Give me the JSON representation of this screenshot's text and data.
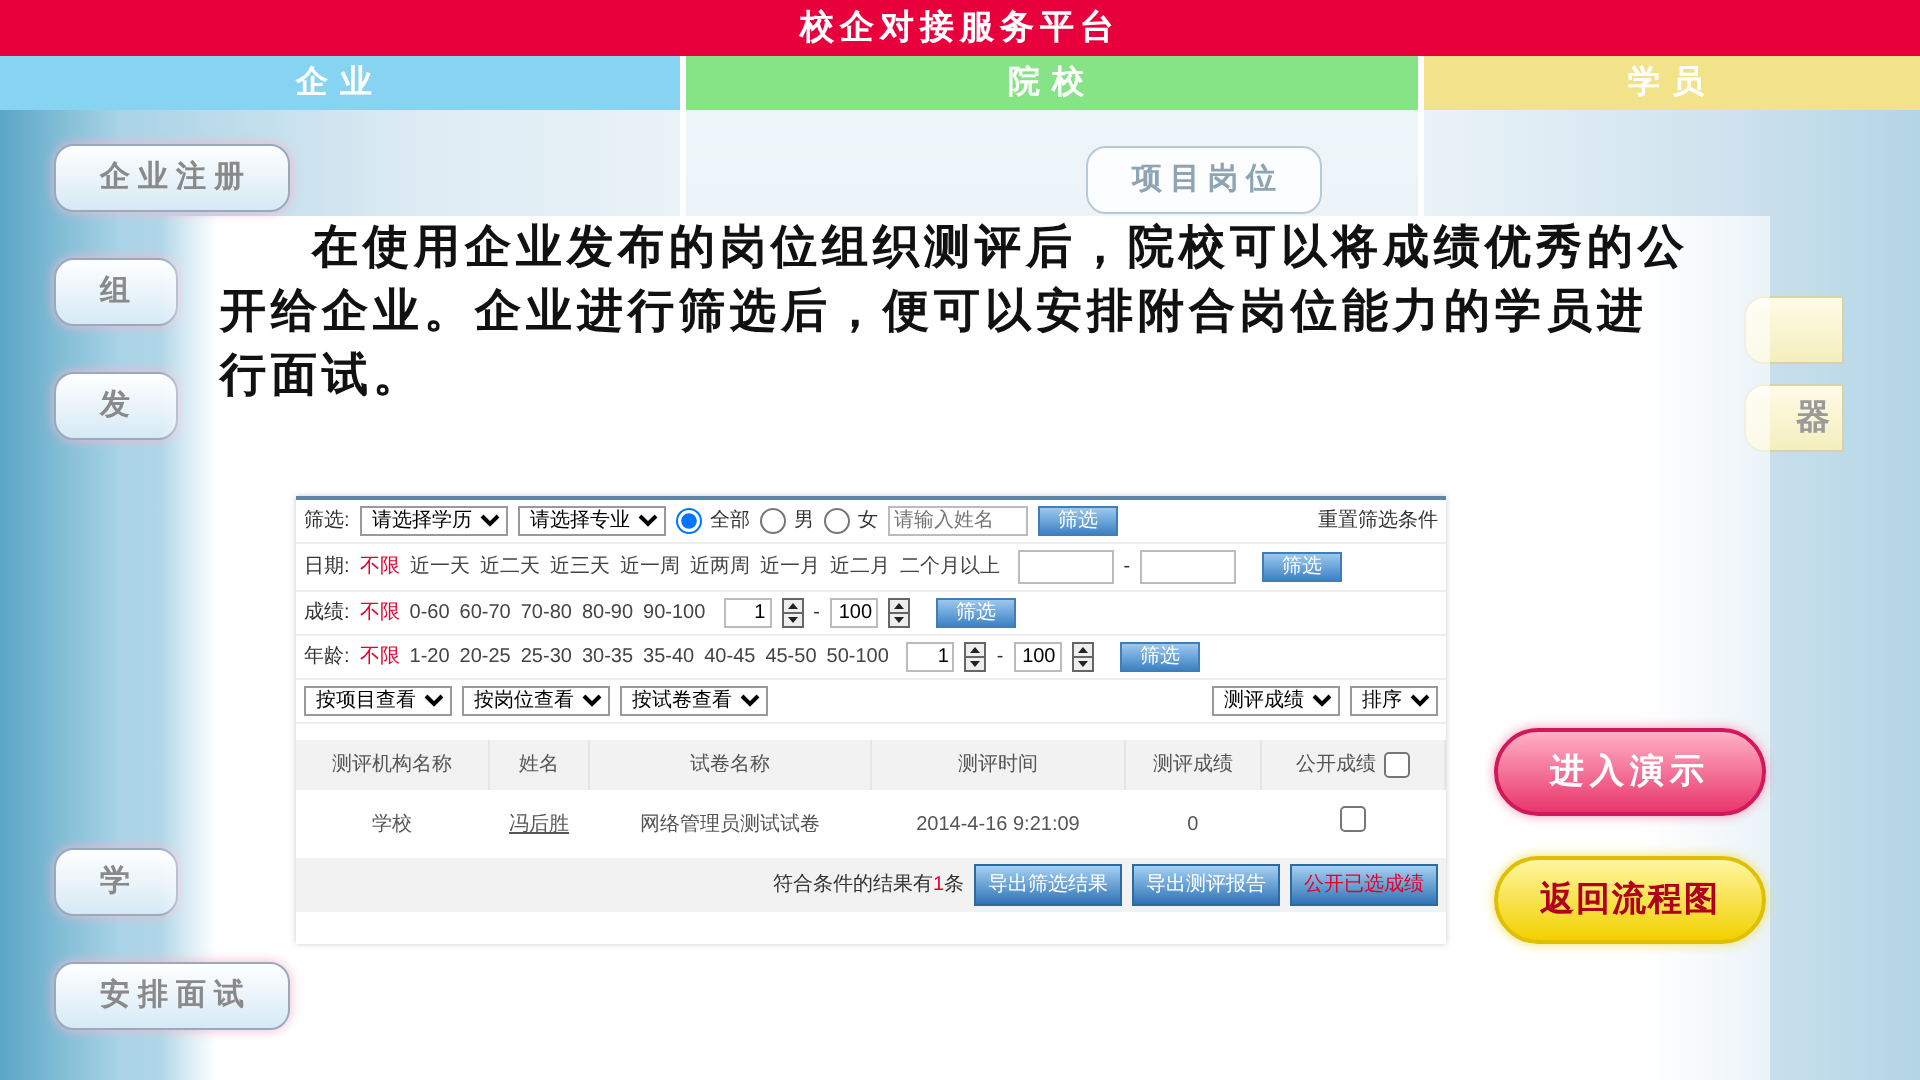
{
  "header": {
    "title": "校企对接服务平台"
  },
  "tabs": [
    {
      "label": "企业",
      "color": "#86d4f2"
    },
    {
      "label": "院校",
      "color": "#86e486"
    },
    {
      "label": "学员",
      "color": "#f2e38a"
    }
  ],
  "enterprise_menu": [
    "企业注册",
    "组",
    "发",
    "学",
    "安排面试"
  ],
  "school_menu": [
    "项目岗位"
  ],
  "student_menu": [
    "器"
  ],
  "description": "在使用企业发布的岗位组织测评后，院校可以将成绩优秀的公开给企业。企业进行筛选后，便可以安排附合岗位能力的学员进行面试。",
  "app": {
    "search_row": {
      "label": "筛选:",
      "selects": [
        "请选择学历",
        "请选择专业"
      ],
      "radios": [
        {
          "label": "全部",
          "selected": true
        },
        {
          "label": "男",
          "selected": false
        },
        {
          "label": "女",
          "selected": false
        }
      ],
      "name_placeholder": "请输入姓名",
      "button": "筛选",
      "reset_link": "重置筛选条件"
    },
    "filter_rows": [
      {
        "kind": "date",
        "label": "日期:",
        "options": [
          {
            "label": "不限",
            "selected": true
          },
          {
            "label": "近一天",
            "selected": false
          },
          {
            "label": "近二天",
            "selected": false
          },
          {
            "label": "近三天",
            "selected": false
          },
          {
            "label": "近一周",
            "selected": false
          },
          {
            "label": "近两周",
            "selected": false
          },
          {
            "label": "近一月",
            "selected": false
          },
          {
            "label": "近二月",
            "selected": false
          },
          {
            "label": "二个月以上",
            "selected": false
          }
        ],
        "separator": "-",
        "button": "筛选"
      },
      {
        "kind": "range",
        "label": "成绩:",
        "options": [
          {
            "label": "不限",
            "selected": true
          },
          {
            "label": "0-60",
            "selected": false
          },
          {
            "label": "60-70",
            "selected": false
          },
          {
            "label": "70-80",
            "selected": false
          },
          {
            "label": "80-90",
            "selected": false
          },
          {
            "label": "90-100",
            "selected": false
          }
        ],
        "from": "1",
        "separator": "-",
        "to": "100",
        "button": "筛选"
      },
      {
        "kind": "range",
        "label": "年龄:",
        "options": [
          {
            "label": "不限",
            "selected": true
          },
          {
            "label": "1-20",
            "selected": false
          },
          {
            "label": "20-25",
            "selected": false
          },
          {
            "label": "25-30",
            "selected": false
          },
          {
            "label": "30-35",
            "selected": false
          },
          {
            "label": "35-40",
            "selected": false
          },
          {
            "label": "40-45",
            "selected": false
          },
          {
            "label": "45-50",
            "selected": false
          },
          {
            "label": "50-100",
            "selected": false
          }
        ],
        "from": "1",
        "separator": "-",
        "to": "100",
        "button": "筛选"
      }
    ],
    "view_selects": [
      "按项目查看",
      "按岗位查看",
      "按试卷查看"
    ],
    "sort_selects": [
      "测评成绩",
      "排序"
    ],
    "table": {
      "columns": [
        "测评机构名称",
        "姓名",
        "试卷名称",
        "测评时间",
        "测评成绩",
        "公开成绩"
      ],
      "select_all_checked": false,
      "rows": [
        {
          "cells": [
            "学校",
            "冯后胜",
            "网络管理员测试试卷",
            "2014-4-16 9:21:09",
            "0"
          ],
          "checked": false
        }
      ]
    },
    "footer": {
      "result_prefix": "符合条件的结果有",
      "result_count": "1",
      "result_suffix": "条",
      "buttons": [
        {
          "label": "导出筛选结果",
          "kind": "normal"
        },
        {
          "label": "导出测评报告",
          "kind": "normal"
        },
        {
          "label": "公开已选成绩",
          "kind": "danger"
        }
      ]
    }
  },
  "actions": [
    {
      "label": "进入演示",
      "kind": "demo"
    },
    {
      "label": "返回流程图",
      "kind": "back"
    }
  ]
}
